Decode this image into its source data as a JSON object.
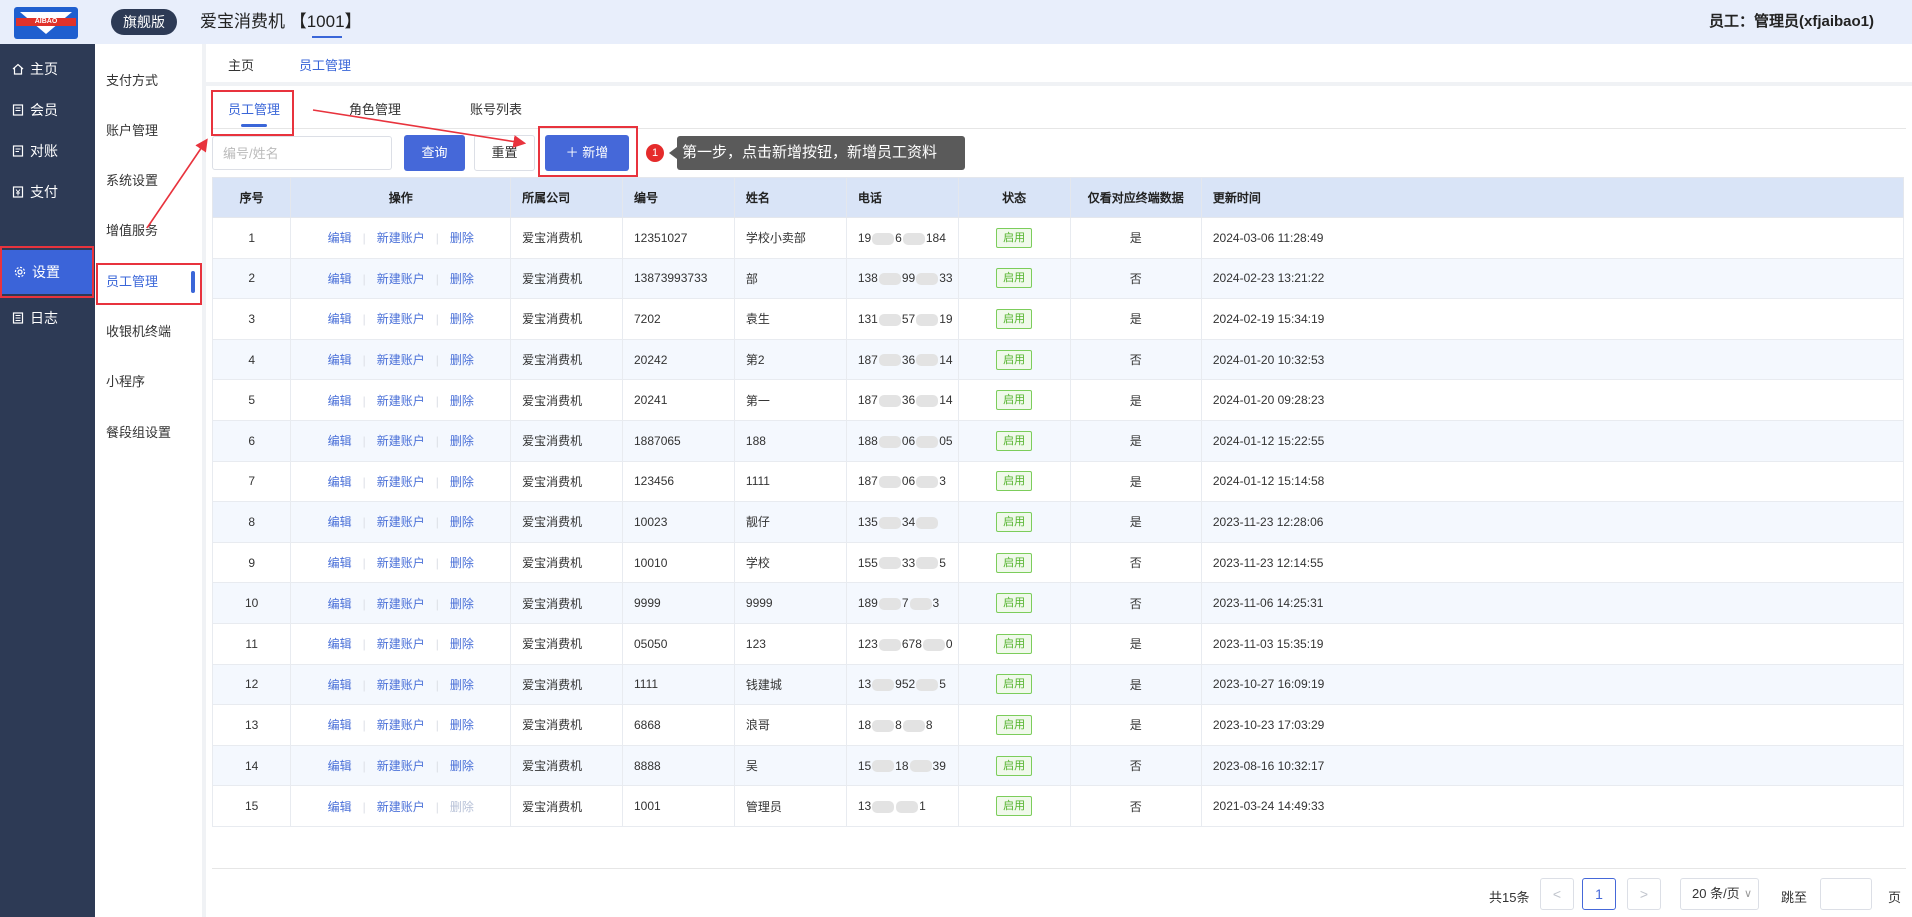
{
  "header": {
    "edition": "旗舰版",
    "app_title": "爱宝消费机 【1001】",
    "user": "员工：管理员(xfjaibao1)",
    "logo_text": "AIBAO"
  },
  "leftnav": [
    {
      "label": "主页",
      "icon": "home-icon"
    },
    {
      "label": "会员",
      "icon": "member-icon"
    },
    {
      "label": "对账",
      "icon": "reconcile-icon"
    },
    {
      "label": "支付",
      "icon": "payment-icon"
    },
    {
      "label": "设置",
      "icon": "gear-icon"
    },
    {
      "label": "日志",
      "icon": "log-icon"
    }
  ],
  "subnav": [
    "支付方式",
    "账户管理",
    "系统设置",
    "增值服务",
    "员工管理",
    "收银机终端",
    "小程序",
    "餐段组设置"
  ],
  "top_tabs": [
    "主页",
    "员工管理"
  ],
  "sub_tabs": [
    "员工管理",
    "角色管理",
    "账号列表"
  ],
  "toolbar": {
    "search_placeholder": "编号/姓名",
    "query": "查询",
    "reset": "重置",
    "add": "新增",
    "step_number": "1",
    "tooltip": "第一步，点击新增按钮，新增员工资料"
  },
  "table": {
    "columns": [
      "序号",
      "操作",
      "所属公司",
      "编号",
      "姓名",
      "电话",
      "状态",
      "仅看对应终端数据",
      "更新时间"
    ],
    "ops": [
      "编辑",
      "新建账户",
      "删除"
    ],
    "status_label": "启用",
    "rows": [
      {
        "idx": "1",
        "company": "爱宝消费机",
        "code": "12351027",
        "name": "学校小卖部",
        "phone_a": "19",
        "phone_b": "6",
        "phone_c": "184",
        "only_terminal": "是",
        "updated": "2024-03-06 11:28:49"
      },
      {
        "idx": "2",
        "company": "爱宝消费机",
        "code": "13873993733",
        "name": "部",
        "phone_a": "138",
        "phone_b": "99",
        "phone_c": "33",
        "only_terminal": "否",
        "updated": "2024-02-23 13:21:22"
      },
      {
        "idx": "3",
        "company": "爱宝消费机",
        "code": "7202",
        "name": "袁生",
        "phone_a": "131",
        "phone_b": "57",
        "phone_c": "19",
        "only_terminal": "是",
        "updated": "2024-02-19 15:34:19"
      },
      {
        "idx": "4",
        "company": "爱宝消费机",
        "code": "20242",
        "name": "第2",
        "phone_a": "187",
        "phone_b": "36",
        "phone_c": "14",
        "only_terminal": "否",
        "updated": "2024-01-20 10:32:53"
      },
      {
        "idx": "5",
        "company": "爱宝消费机",
        "code": "20241",
        "name": "第一",
        "phone_a": "187",
        "phone_b": "36",
        "phone_c": "14",
        "only_terminal": "是",
        "updated": "2024-01-20 09:28:23"
      },
      {
        "idx": "6",
        "company": "爱宝消费机",
        "code": "1887065",
        "name": "188",
        "phone_a": "188",
        "phone_b": "06",
        "phone_c": "05",
        "only_terminal": "是",
        "updated": "2024-01-12 15:22:55"
      },
      {
        "idx": "7",
        "company": "爱宝消费机",
        "code": "123456",
        "name": "1111",
        "phone_a": "187",
        "phone_b": "06",
        "phone_c": "3",
        "only_terminal": "是",
        "updated": "2024-01-12 15:14:58"
      },
      {
        "idx": "8",
        "company": "爱宝消费机",
        "code": "10023",
        "name": "靓仔",
        "phone_a": "135",
        "phone_b": "34",
        "phone_c": "",
        "only_terminal": "是",
        "updated": "2023-11-23 12:28:06"
      },
      {
        "idx": "9",
        "company": "爱宝消费机",
        "code": "10010",
        "name": "学校",
        "phone_a": "155",
        "phone_b": "33",
        "phone_c": "5",
        "only_terminal": "否",
        "updated": "2023-11-23 12:14:55"
      },
      {
        "idx": "10",
        "company": "爱宝消费机",
        "code": "9999",
        "name": "9999",
        "phone_a": "189",
        "phone_b": "7",
        "phone_c": "3",
        "only_terminal": "否",
        "updated": "2023-11-06 14:25:31"
      },
      {
        "idx": "11",
        "company": "爱宝消费机",
        "code": "05050",
        "name": "123",
        "phone_a": "123",
        "phone_b": "678",
        "phone_c": "0",
        "only_terminal": "是",
        "updated": "2023-11-03 15:35:19"
      },
      {
        "idx": "12",
        "company": "爱宝消费机",
        "code": "1111",
        "name": "钱建城",
        "phone_a": "13",
        "phone_b": "952",
        "phone_c": "5",
        "only_terminal": "是",
        "updated": "2023-10-27 16:09:19"
      },
      {
        "idx": "13",
        "company": "爱宝消费机",
        "code": "6868",
        "name": "浪哥",
        "phone_a": "18",
        "phone_b": "8",
        "phone_c": "8",
        "only_terminal": "是",
        "updated": "2023-10-23 17:03:29"
      },
      {
        "idx": "14",
        "company": "爱宝消费机",
        "code": "8888",
        "name": "吴",
        "phone_a": "15",
        "phone_b": "18",
        "phone_c": "39",
        "only_terminal": "否",
        "updated": "2023-08-16 10:32:17"
      },
      {
        "idx": "15",
        "company": "爱宝消费机",
        "code": "1001",
        "name": "管理员",
        "phone_a": "13",
        "phone_b": "",
        "phone_c": "1",
        "only_terminal": "否",
        "updated": "2021-03-24 14:49:33"
      }
    ]
  },
  "pagination": {
    "total": "共15条",
    "prev": "<",
    "current": "1",
    "next": ">",
    "page_size": "20 条/页",
    "jump_label": "跳至",
    "page_suffix": "页"
  },
  "colors": {
    "sidebar": "#2d3a55",
    "accent": "#3b64d9",
    "highlight_box": "#e8333d",
    "status_green": "#52b32b"
  }
}
